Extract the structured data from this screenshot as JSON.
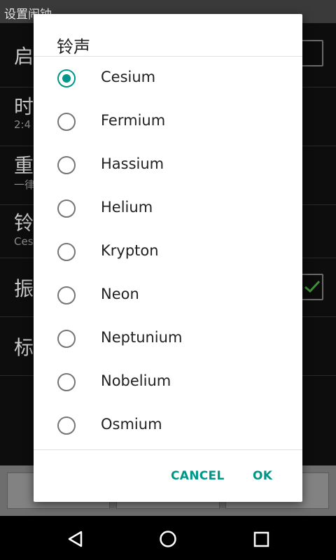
{
  "background": {
    "app_title": "设置闹钟",
    "rows": [
      {
        "title": "启",
        "subtitle": ""
      },
      {
        "title": "时",
        "subtitle": "2:4"
      },
      {
        "title": "重",
        "subtitle": "一律"
      },
      {
        "title": "铃",
        "subtitle": "Ces"
      },
      {
        "title": "振",
        "subtitle": ""
      },
      {
        "title": "标",
        "subtitle": ""
      }
    ]
  },
  "dialog": {
    "title": "铃声",
    "selected_index": 0,
    "options": [
      "Cesium",
      "Fermium",
      "Hassium",
      "Helium",
      "Krypton",
      "Neon",
      "Neptunium",
      "Nobelium",
      "Osmium"
    ],
    "cancel_label": "CANCEL",
    "ok_label": "OK"
  },
  "navbar": {
    "back_icon": "back-triangle-icon",
    "home_icon": "home-circle-icon",
    "recents_icon": "recents-square-icon"
  },
  "colors": {
    "accent": "#009688",
    "dialog_bg": "#ffffff",
    "scrim_bg": "#0d0d0d"
  }
}
